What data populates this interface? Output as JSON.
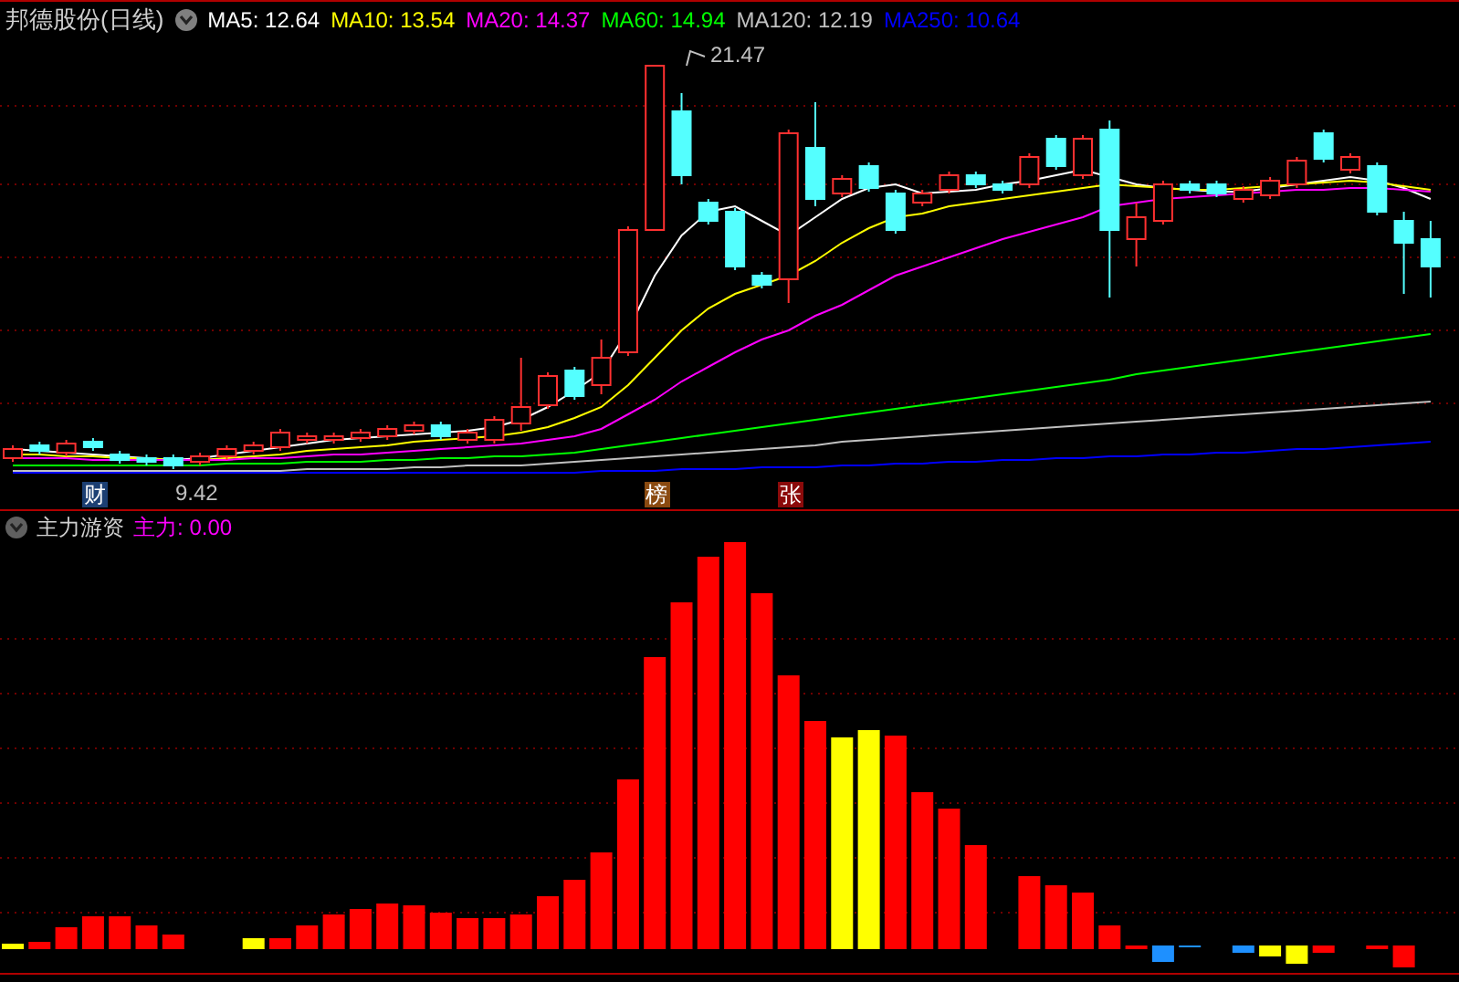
{
  "header": {
    "stock_name": "邦德股份(日线)",
    "moving_averages": [
      {
        "label": "MA5:",
        "value": "12.64",
        "color": "#ffffff"
      },
      {
        "label": "MA10:",
        "value": "13.54",
        "color": "#ffff00"
      },
      {
        "label": "MA20:",
        "value": "14.37",
        "color": "#ff00ff"
      },
      {
        "label": "MA60:",
        "value": "14.94",
        "color": "#00ff00"
      },
      {
        "label": "MA120:",
        "value": "12.19",
        "color": "#c0c0c0"
      },
      {
        "label": "MA250:",
        "value": "10.64",
        "color": "#0000ff"
      }
    ]
  },
  "price_chart": {
    "high_label": "21.47",
    "low_label": "9.42"
  },
  "event_markers": [
    {
      "label": "财",
      "color": "#1c3f73"
    },
    {
      "label": "榜",
      "color": "#8a4a10"
    },
    {
      "label": "张",
      "color": "#8b0a0a"
    }
  ],
  "indicator_panel": {
    "name": "主力游资",
    "reading_label": "主力:",
    "reading_value": "0.00"
  }
}
